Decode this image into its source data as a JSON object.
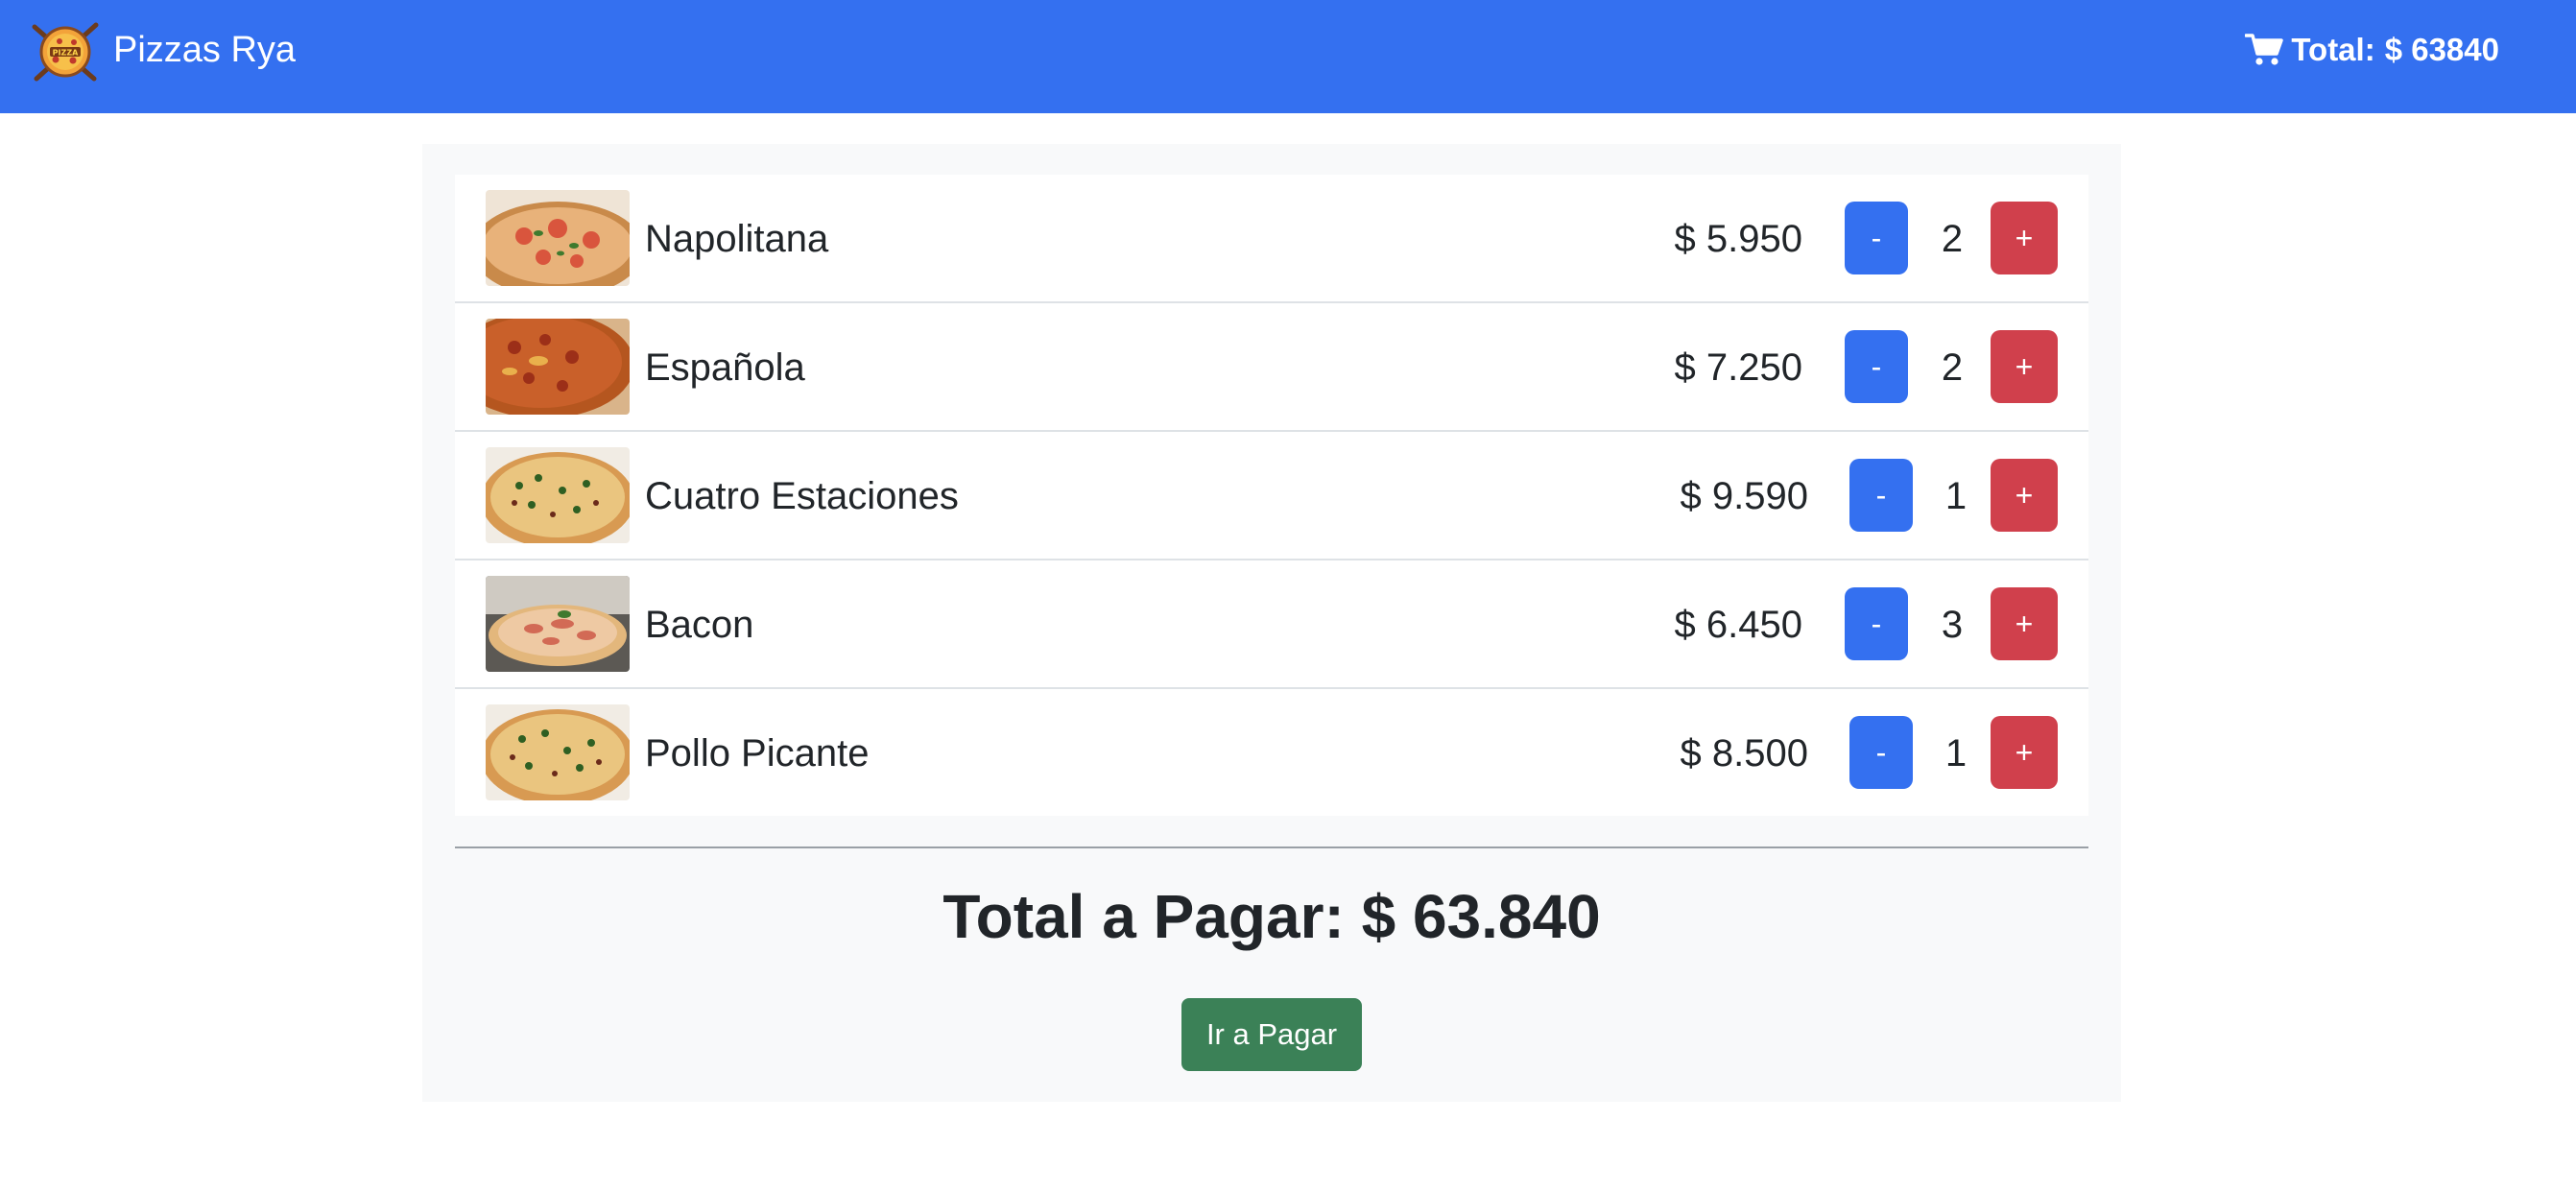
{
  "navbar": {
    "brand": "Pizzas Rya",
    "logo_icon": "pizza-logo-icon",
    "cart_icon": "shopping-cart-icon",
    "cart_label": "Total:",
    "cart_total": "$ 63840",
    "bg_color": "#3470f0"
  },
  "cart": {
    "items": [
      {
        "name": "Napolitana",
        "price": "$ 5.950",
        "quantity": "2",
        "minus_label": "-",
        "plus_label": "+"
      },
      {
        "name": "Española",
        "price": "$ 7.250",
        "quantity": "2",
        "minus_label": "-",
        "plus_label": "+"
      },
      {
        "name": "Cuatro Estaciones",
        "price": "$ 9.590",
        "quantity": "1",
        "minus_label": "-",
        "plus_label": "+"
      },
      {
        "name": "Bacon",
        "price": "$ 6.450",
        "quantity": "3",
        "minus_label": "-",
        "plus_label": "+"
      },
      {
        "name": "Pollo Picante",
        "price": "$ 8.500",
        "quantity": "1",
        "minus_label": "-",
        "plus_label": "+"
      }
    ],
    "total_text": "Total a Pagar: $ 63.840",
    "pay_button": "Ir a Pagar"
  },
  "colors": {
    "minus_button": "#3470f0",
    "plus_button": "#d0404c",
    "pay_button": "#3b8157"
  }
}
